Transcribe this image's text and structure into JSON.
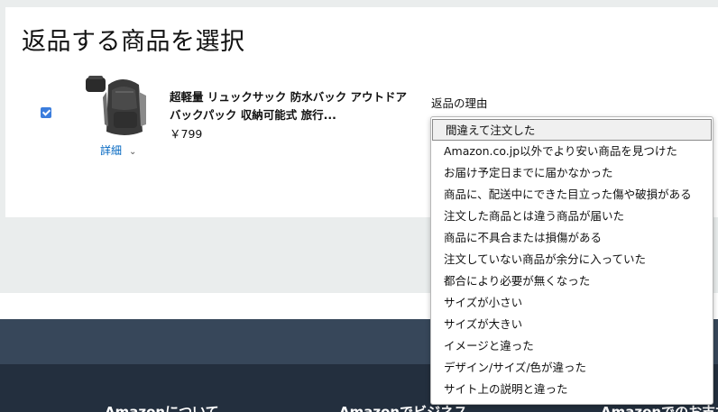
{
  "page": {
    "title": "返品する商品を選択"
  },
  "item": {
    "checked": true,
    "name": "超軽量 リュックサック 防水バック アウトドア バックパック 収納可能式 旅行...",
    "price": "￥799",
    "details_label": "詳細"
  },
  "reason": {
    "label": "返品の理由",
    "selected_index": 0,
    "options": [
      "間違えて注文した",
      "Amazon.co.jp以外でより安い商品を見つけた",
      "お届け予定日までに届かなかった",
      "商品に、配送中にできた目立った傷や破損がある",
      "注文した商品とは違う商品が届いた",
      "商品に不具合または損傷がある",
      "注文していない商品が余分に入っていた",
      "都合により必要が無くなった",
      "サイズが小さい",
      "サイズが大きい",
      "イメージと違った",
      "デザイン/サイズ/色が違った",
      "サイト上の説明と違った"
    ]
  },
  "footer": {
    "columns": [
      "Amazonについて",
      "Amazonでビジネス",
      "Amazonでのお支払い"
    ]
  },
  "colors": {
    "checkbox": "#3b7ddd",
    "link": "#0066c0",
    "footer_top": "#37475a",
    "footer_main": "#232f3e"
  }
}
